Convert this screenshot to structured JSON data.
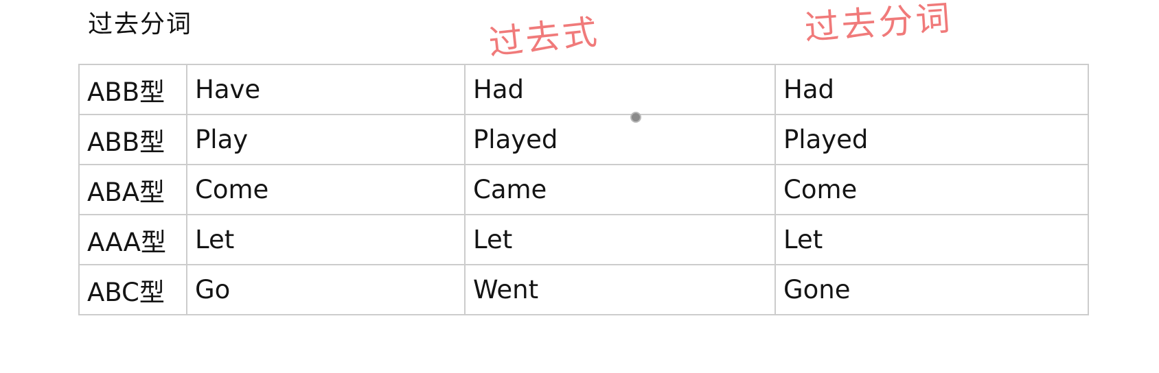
{
  "title": "过去分词",
  "annotations": {
    "past_tense": "过去式",
    "past_participle": "过去分词"
  },
  "rows": [
    {
      "type": "ABB型",
      "base": "Have",
      "past": "Had",
      "participle": "Had"
    },
    {
      "type": "ABB型",
      "base": "Play",
      "past": "Played",
      "participle": "Played"
    },
    {
      "type": "ABA型",
      "base": "Come",
      "past": "Came",
      "participle": "Come"
    },
    {
      "type": "AAA型",
      "base": "Let",
      "past": "Let",
      "participle": "Let"
    },
    {
      "type": "ABC型",
      "base": "Go",
      "past": "Went",
      "participle": "Gone"
    }
  ],
  "colors": {
    "annotation": "#f07a7a",
    "border": "#cccccc",
    "text": "#141414"
  }
}
